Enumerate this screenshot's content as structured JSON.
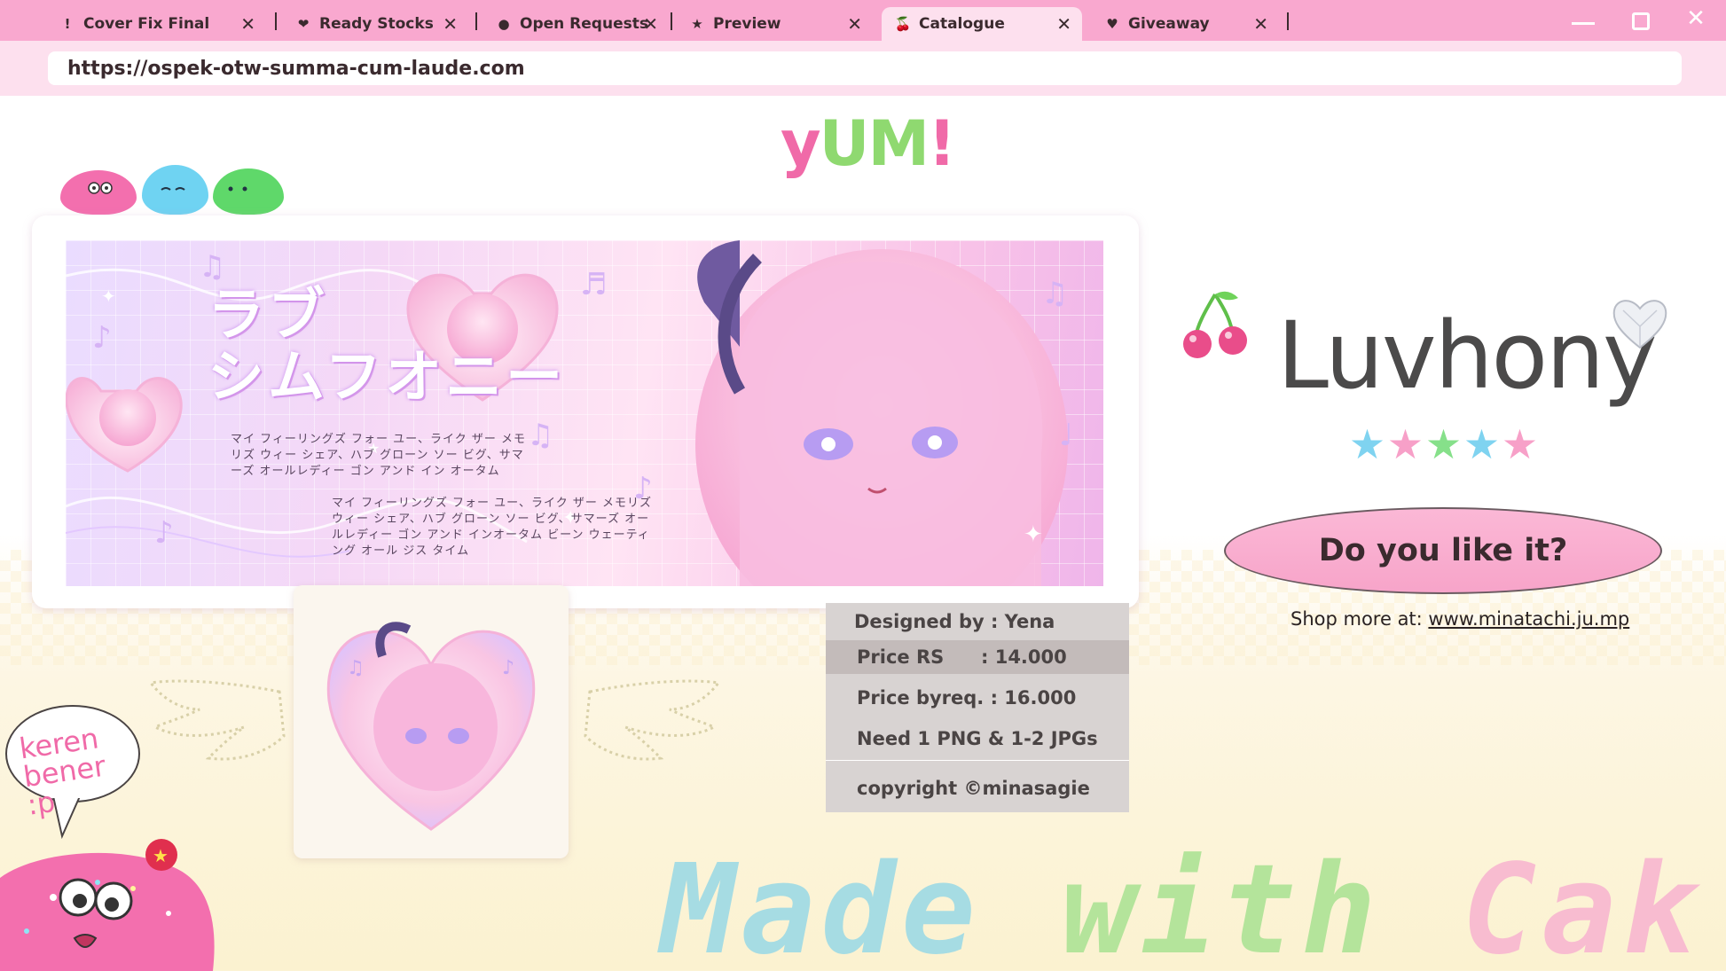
{
  "browser": {
    "tabs": [
      {
        "label": "Cover Fix Final",
        "icon": "!"
      },
      {
        "label": "Ready Stocks",
        "icon": "heart-icon"
      },
      {
        "label": "Open Requests",
        "icon": "apple-icon"
      },
      {
        "label": "Preview",
        "icon": "star-icon"
      },
      {
        "label": "Catalogue",
        "icon": "cherry-icon",
        "active": true
      },
      {
        "label": "Giveaway",
        "icon": "strawberry-icon"
      }
    ],
    "url": "https://ospek-otw-summa-cum-laude.com",
    "colors": {
      "tabbar": "#f9a8cf",
      "active_tab": "#fde0ee"
    }
  },
  "site": {
    "logo": {
      "part1": "y",
      "part2": "UM",
      "part3": "!"
    }
  },
  "banner": {
    "title_line1": "ラブ",
    "title_line2": "シムフオニー",
    "lyrics_1": "マイ フィーリングズ フォー ユー、ライク ザー メモリズ ウィー シェア、ハブ グローン ソー ビグ、サマーズ オールレディー ゴン アンド イン オータム",
    "lyrics_2": "マイ フィーリングズ フォー ユー、ライク ザー メモリズ ウィー シェア、ハブ グローン ソー ビグ、サマーズ オールレディー ゴン アンド インオータム ビーン ウェーティング オール ジス タイム"
  },
  "info": {
    "designed_by": "Designed by : Yena",
    "price_rs_label": "Price RS",
    "price_rs_value": ": 14.000",
    "price_byreq": "Price byreq. : 16.000",
    "need": "Need 1 PNG & 1-2 JPGs",
    "copyright": "copyright ©minasagie"
  },
  "product": {
    "name": "Luvhony",
    "rating": 5,
    "star_colors": [
      "#7fd3f0",
      "#f7a0c8",
      "#86e08a",
      "#7fd3f0",
      "#f7a0c8"
    ],
    "cta": "Do you like it?",
    "shop_prefix": "Shop more at: ",
    "shop_link": "www.minatachi.ju.mp"
  },
  "bubble": {
    "text_line1": "keren",
    "text_line2": "bener :p"
  },
  "footer_art": {
    "w1": "Made",
    "w2": "with",
    "w3": "Cak"
  }
}
